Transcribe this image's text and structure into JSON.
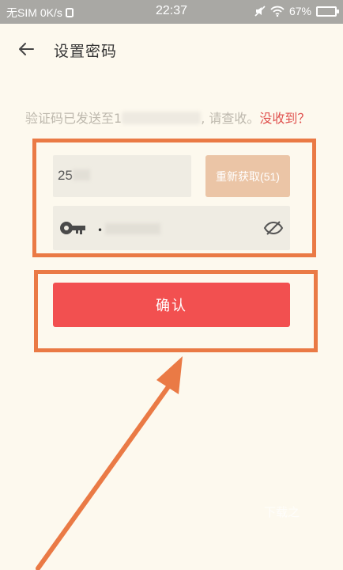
{
  "status_bar": {
    "carrier": "无SIM",
    "net_speed": "0K/s",
    "time": "22:37",
    "battery": "67%"
  },
  "header": {
    "back_icon": "arrow-left-icon",
    "title": "设置密码"
  },
  "hint": {
    "prefix": "验证码已发送至1",
    "suffix": ", 请查收。",
    "link": "没收到？"
  },
  "form": {
    "code_value": "25",
    "resend_label": "重新获取(51)",
    "password_dots": "•",
    "key_icon": "key-icon",
    "eye_icon": "eye-off-icon"
  },
  "confirm_label": "确认",
  "watermark": "下载之",
  "colors": {
    "primary": "#f25050",
    "resend": "#ebc5a6",
    "annotation": "#ea7a45",
    "background": "#fdf9ee"
  }
}
